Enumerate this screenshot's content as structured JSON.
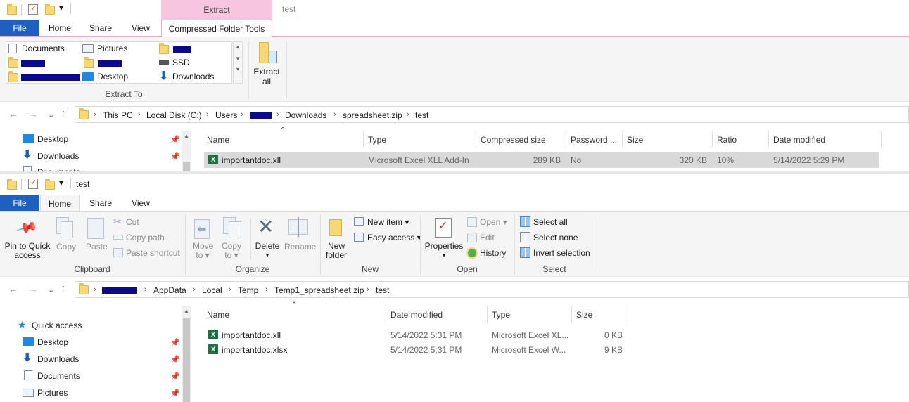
{
  "top": {
    "qat_arrow": "▾",
    "context_tab": "Extract",
    "window_title": "test",
    "tabs": {
      "file": "File",
      "home": "Home",
      "share": "Share",
      "view": "View",
      "tools": "Compressed Folder Tools"
    },
    "extract_to": {
      "items": {
        "documents": "Documents",
        "pictures": "Pictures",
        "ssd": "SSD",
        "desktop": "Desktop",
        "downloads": "Downloads"
      },
      "group_label": "Extract To"
    },
    "extract_all": {
      "line1": "Extract",
      "line2": "all"
    },
    "breadcrumb": [
      "This PC",
      "Local Disk (C:)",
      "Users",
      "Downloads",
      "spreadsheet.zip",
      "test"
    ],
    "nav": [
      "Desktop",
      "Downloads",
      "Documents"
    ],
    "columns": {
      "name": "Name",
      "type": "Type",
      "csize": "Compressed size",
      "password": "Password ...",
      "size": "Size",
      "ratio": "Ratio",
      "date": "Date modified"
    },
    "row": {
      "name": "importantdoc.xll",
      "type": "Microsoft Excel XLL Add-In",
      "csize": "289 KB",
      "password": "No",
      "size": "320 KB",
      "ratio": "10%",
      "date": "5/14/2022 5:29 PM"
    }
  },
  "bottom": {
    "qat_arrow": "▾",
    "window_title": "test",
    "tabs": {
      "file": "File",
      "home": "Home",
      "share": "Share",
      "view": "View"
    },
    "clipboard": {
      "pin_line1": "Pin to Quick",
      "pin_line2": "access",
      "copy": "Copy",
      "paste": "Paste",
      "cut": "Cut",
      "copy_path": "Copy path",
      "paste_shortcut": "Paste shortcut",
      "label": "Clipboard"
    },
    "organize": {
      "move_to": "Move",
      "to1": "to ▾",
      "copy_to": "Copy",
      "to2": "to ▾",
      "delete": "Delete",
      "delete_arrow": "▾",
      "rename": "Rename",
      "label": "Organize"
    },
    "new": {
      "new_folder1": "New",
      "new_folder2": "folder",
      "new_item": "New item ▾",
      "easy_access": "Easy access ▾",
      "label": "New"
    },
    "open": {
      "properties": "Properties",
      "properties_arrow": "▾",
      "open": "Open ▾",
      "edit": "Edit",
      "history": "History",
      "label": "Open"
    },
    "select": {
      "all": "Select all",
      "none": "Select none",
      "invert": "Invert selection",
      "label": "Select"
    },
    "breadcrumb": [
      "AppData",
      "Local",
      "Temp",
      "Temp1_spreadsheet.zip",
      "test"
    ],
    "nav": [
      "Quick access",
      "Desktop",
      "Downloads",
      "Documents",
      "Pictures"
    ],
    "columns": {
      "name": "Name",
      "date": "Date modified",
      "type": "Type",
      "size": "Size"
    },
    "rows": [
      {
        "name": "importantdoc.xll",
        "date": "5/14/2022 5:31 PM",
        "type": "Microsoft Excel XL...",
        "size": "0 KB"
      },
      {
        "name": "importantdoc.xlsx",
        "date": "5/14/2022 5:31 PM",
        "type": "Microsoft Excel W...",
        "size": "9 KB"
      }
    ]
  }
}
